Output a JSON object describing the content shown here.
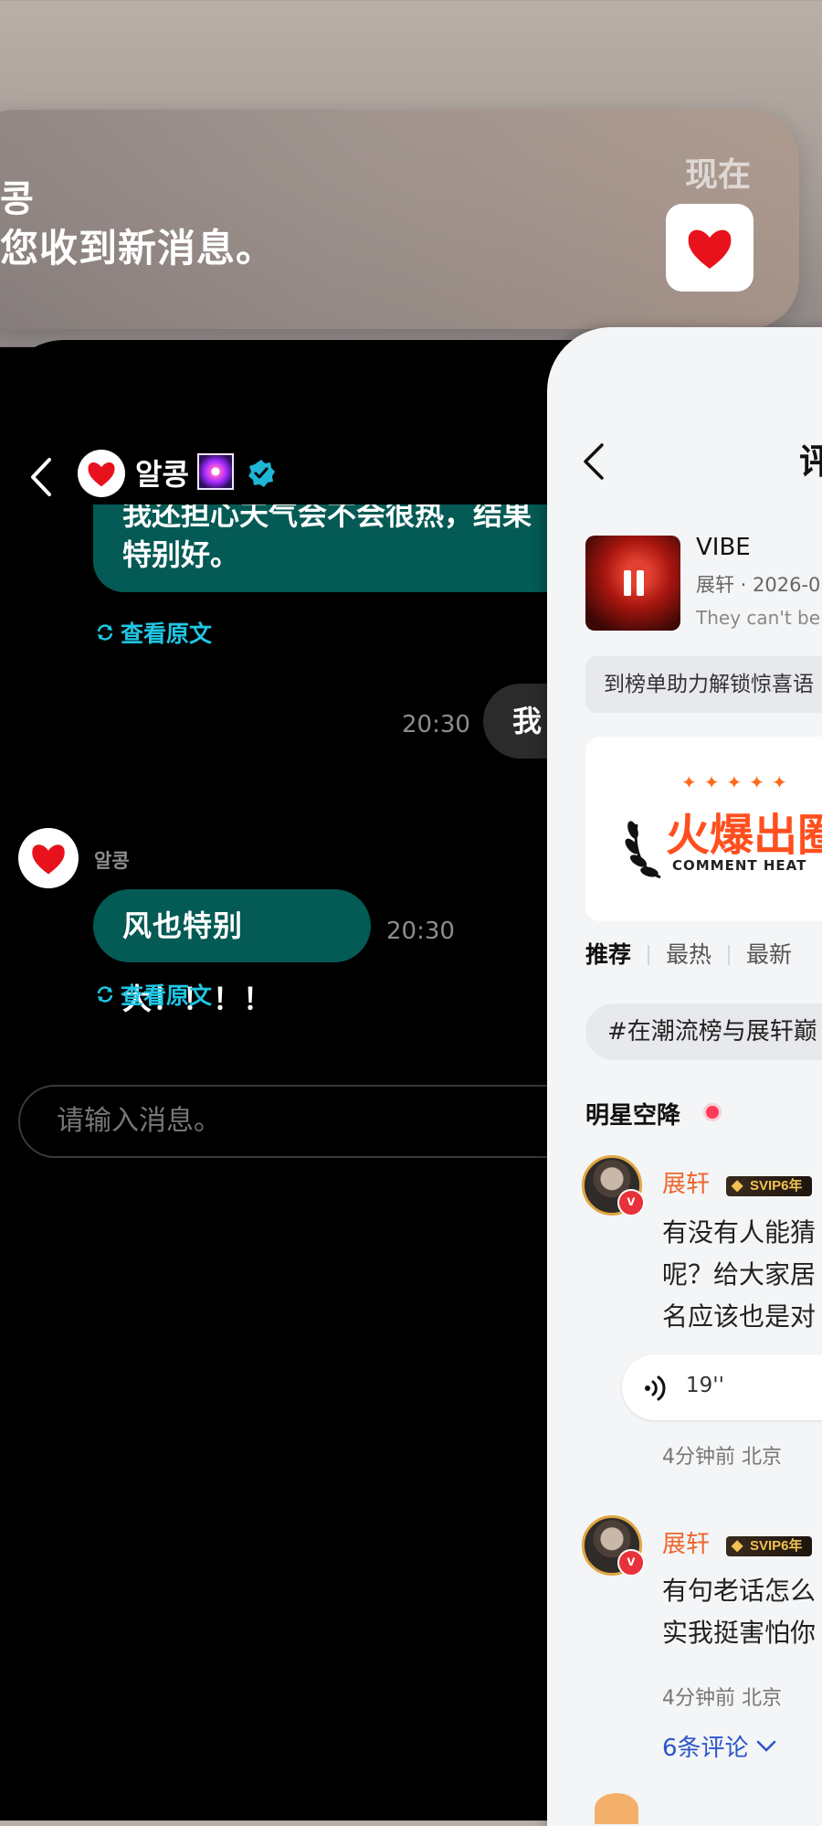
{
  "notification": {
    "sender": "콩",
    "message": "您收到新消息。",
    "time": "现在",
    "app_icon": "red-heart-icon"
  },
  "chat": {
    "contact_name": "알콩",
    "contact_name_small": "알콩",
    "emoji_icon": "firework-emoji-icon",
    "verified_icon": "verified-badge-icon",
    "messages": [
      {
        "line1": "我还担心天气会不会很热，结果",
        "line2": "特别好。",
        "translate": "查看原文"
      },
      {
        "text": "我",
        "time": "20:30"
      },
      {
        "text": "风也特别大！！！！",
        "time": "20:30",
        "translate": "查看原文"
      }
    ],
    "input_placeholder": "请输入消息。"
  },
  "comments": {
    "title": "评",
    "song": {
      "title": "VIBE",
      "meta": "展轩 · 2026-0",
      "desc": "They can't be"
    },
    "promo": "到榜单助力解锁惊喜语",
    "banner": {
      "stars": "✦✦✦✦✦",
      "main": "火爆出圈",
      "sub": "COMMENT HEAT"
    },
    "tabs": [
      "推荐",
      "最热",
      "最新"
    ],
    "topic": "#在潮流榜与展轩巅",
    "section": "明星空降",
    "items": [
      {
        "name": "展轩",
        "badge": "SVIP6年",
        "lines": [
          "有没有人能猜",
          "呢？给大家居",
          "名应该也是对"
        ],
        "voice": "19''",
        "meta": "4分钟前 北京"
      },
      {
        "name": "展轩",
        "badge": "SVIP6年",
        "lines": [
          "有句老话怎么",
          "实我挺害怕你"
        ],
        "meta": "4分钟前 北京",
        "more": "6条评论"
      }
    ]
  }
}
